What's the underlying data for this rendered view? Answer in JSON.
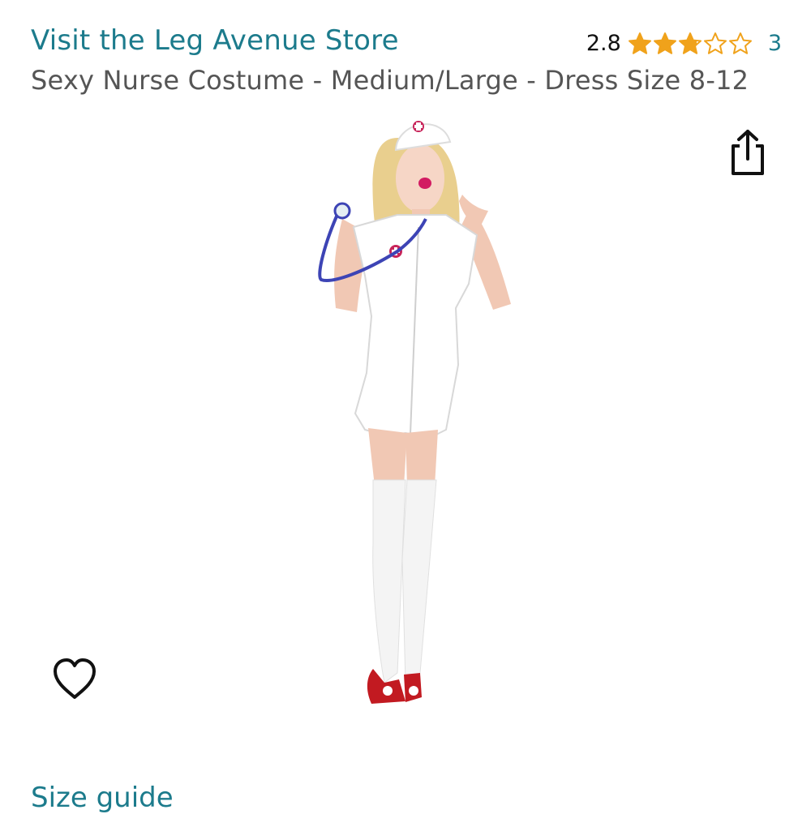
{
  "store": {
    "link_label": "Visit the Leg Avenue Store"
  },
  "rating": {
    "value": "2.8",
    "stars_filled": 2.8,
    "stars_total": 5,
    "count": "3",
    "star_color": "#f0a21b"
  },
  "product": {
    "title": "Sexy Nurse Costume - Medium/Large - Dress Size 8-12",
    "image_icon": "nurse-costume-product-photo"
  },
  "actions": {
    "share_icon": "share-icon",
    "wishlist_icon": "heart-icon"
  },
  "links": {
    "size_guide": "Size guide"
  },
  "colors": {
    "link": "#1c7b8c",
    "title": "#555555"
  }
}
